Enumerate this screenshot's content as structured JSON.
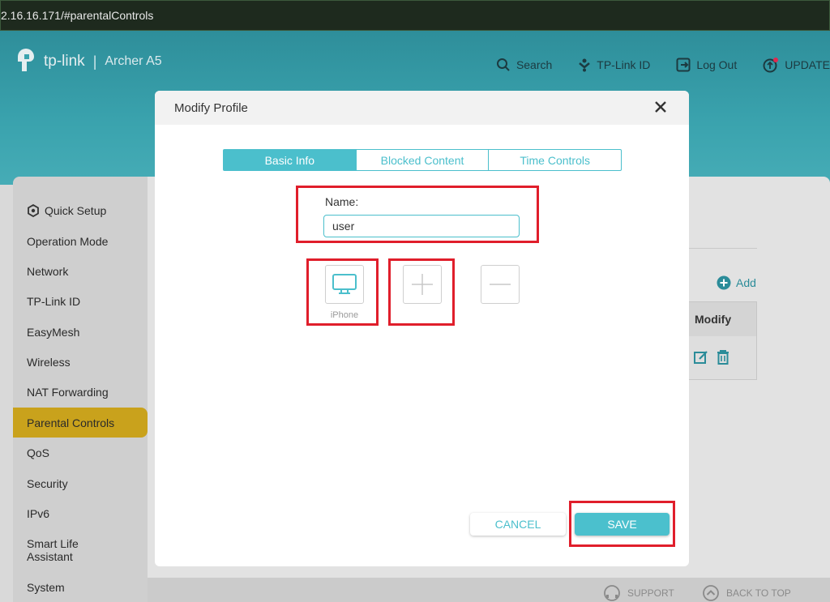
{
  "browser": {
    "url": "2.16.16.171/#parentalControls"
  },
  "header": {
    "brand": "tp-link",
    "model": "Archer A5",
    "nav": [
      {
        "label": "Search",
        "icon": "search-icon"
      },
      {
        "label": "TP-Link ID",
        "icon": "tplink-id-icon"
      },
      {
        "label": "Log Out",
        "icon": "logout-icon"
      },
      {
        "label": "UPDATE",
        "icon": "update-icon"
      }
    ]
  },
  "sidebar": {
    "items": [
      {
        "label": "Quick Setup",
        "icon": "gear-icon"
      },
      {
        "label": "Operation Mode"
      },
      {
        "label": "Network"
      },
      {
        "label": "TP-Link ID"
      },
      {
        "label": "EasyMesh"
      },
      {
        "label": "Wireless"
      },
      {
        "label": "NAT Forwarding"
      },
      {
        "label": "Parental Controls",
        "active": true
      },
      {
        "label": "QoS"
      },
      {
        "label": "Security"
      },
      {
        "label": "IPv6"
      },
      {
        "label": "Smart Life Assistant"
      },
      {
        "label": "System"
      }
    ]
  },
  "background": {
    "add_label": "Add",
    "table_header_modify": "Modify"
  },
  "footer": {
    "support": "SUPPORT",
    "back_to_top": "BACK TO TOP"
  },
  "modal": {
    "title": "Modify Profile",
    "tabs": [
      {
        "label": "Basic Info",
        "active": true
      },
      {
        "label": "Blocked Content"
      },
      {
        "label": "Time Controls"
      }
    ],
    "name_label": "Name:",
    "name_value": "user",
    "device_label": "iPhone",
    "cancel_label": "CANCEL",
    "save_label": "SAVE"
  },
  "colors": {
    "accent": "#4bbfcc",
    "active_sidebar": "#c9a21c",
    "highlight": "#e01e2b"
  }
}
